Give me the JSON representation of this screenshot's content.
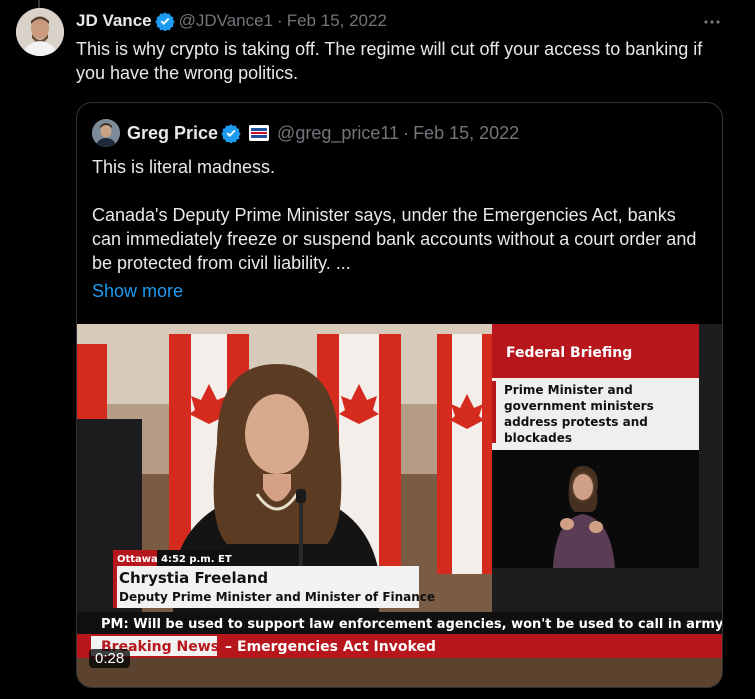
{
  "tweet": {
    "author_name": "JD Vance",
    "author_handle": "@JDVance1",
    "separator": "·",
    "date": "Feb 15, 2022",
    "text": "This is why crypto is taking off. The regime will cut off your access to banking if you have the wrong politics.",
    "more_icon": "more-horizontal-icon"
  },
  "quote": {
    "author_name": "Greg Price",
    "author_handle": "@greg_price11",
    "separator": "·",
    "date": "Feb 15, 2022",
    "line1": "This is literal madness.",
    "line2": "Canada's Deputy Prime Minister says, under the Emergencies Act, banks can immediately freeze or suspend bank accounts without a court order and be protected from civil liability. ...",
    "show_more": "Show more"
  },
  "video": {
    "panel_title": "Federal Briefing",
    "panel_headline": "Prime Minister and government ministers address protests and blockades",
    "location": "Ottawa",
    "time": "4:52 p.m. ET",
    "person_name": "Chrystia Freeland",
    "person_title": "Deputy Prime Minister and Minister of Finance",
    "ticker": "PM: Will be used to support law enforcement agencies, won't be used to call in army",
    "breaking_label": "Breaking News",
    "breaking_text": "Emergencies Act Invoked",
    "duration": "0:28"
  },
  "colors": {
    "background": "#000000",
    "text": "#e7e9ea",
    "muted": "#71767b",
    "link": "#1d9bf0",
    "verified": "#1d9bf0",
    "news_red": "#c8102e"
  }
}
